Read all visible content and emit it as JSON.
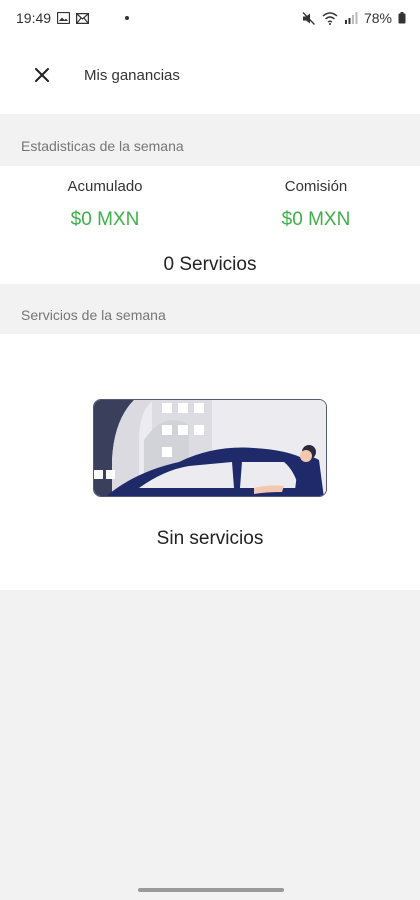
{
  "status_bar": {
    "time": "19:49",
    "battery": "78%",
    "icons": [
      "gallery-icon",
      "mail-icon",
      "mute-icon",
      "wifi-icon",
      "signal-icon",
      "battery-icon"
    ]
  },
  "header": {
    "title": "Mis ganancias",
    "close_icon": "close-icon"
  },
  "weekly_stats": {
    "section_title": "Estadisticas de la semana",
    "accumulated_label": "Acumulado",
    "accumulated_value": "$0 MXN",
    "commission_label": "Comisión",
    "commission_value": "$0 MXN",
    "services_count": "0 Servicios"
  },
  "weekly_services": {
    "section_title": "Servicios de la semana",
    "empty_message": "Sin servicios",
    "illustration": "car-driver-illustration"
  },
  "colors": {
    "accent_green": "#3faf49",
    "illustration_navy": "#1f2a6b",
    "background": "#f2f2f2"
  }
}
